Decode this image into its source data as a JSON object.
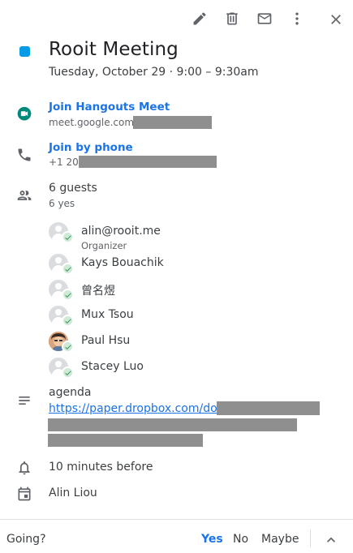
{
  "toolbar": {
    "edit_icon": "pencil-icon",
    "delete_icon": "trash-icon",
    "email_icon": "mail-icon",
    "more_icon": "more-vert-icon",
    "close_icon": "close-icon"
  },
  "event": {
    "color": "#039be5",
    "title": "Rooit Meeting",
    "datetime": "Tuesday, October 29 · 9:00 – 9:30am"
  },
  "hangouts": {
    "label": "Join Hangouts Meet",
    "url_prefix": "meet.google.com/"
  },
  "phone": {
    "label": "Join by phone",
    "number_prefix": "+1 208"
  },
  "guests": {
    "title": "6 guests",
    "summary": "6 yes",
    "list": [
      {
        "name": "alin@rooit.me",
        "role": "Organizer"
      },
      {
        "name": "Kays Bouachik"
      },
      {
        "name": "曾名煜"
      },
      {
        "name": "Mux Tsou"
      },
      {
        "name": "Paul Hsu"
      },
      {
        "name": "Stacey Luo"
      }
    ]
  },
  "description": {
    "text": "agenda",
    "link_prefix": "https://paper.dropbox.com/doc/"
  },
  "reminder": "10 minutes before",
  "calendar_owner": "Alin Liou",
  "footer": {
    "going_label": "Going?",
    "yes": "Yes",
    "no": "No",
    "maybe": "Maybe",
    "accent": "#1a73e8"
  }
}
